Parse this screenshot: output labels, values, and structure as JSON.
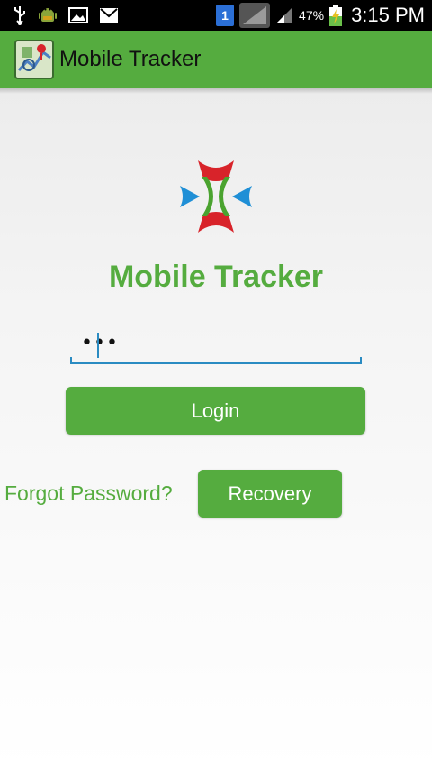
{
  "status_bar": {
    "battery_percent": "47%",
    "time": "3:15 PM",
    "notification_badge": "1"
  },
  "action_bar": {
    "title": "Mobile Tracker"
  },
  "login": {
    "brand_title": "Mobile Tracker",
    "password_value": "•••",
    "login_label": "Login",
    "forgot_label": "Forgot Password?",
    "recovery_label": "Recovery"
  },
  "colors": {
    "brand_green": "#55ac3f",
    "accent_blue": "#2a8bc2",
    "logo_red": "#d8232a",
    "logo_blue": "#1f8fd6"
  }
}
